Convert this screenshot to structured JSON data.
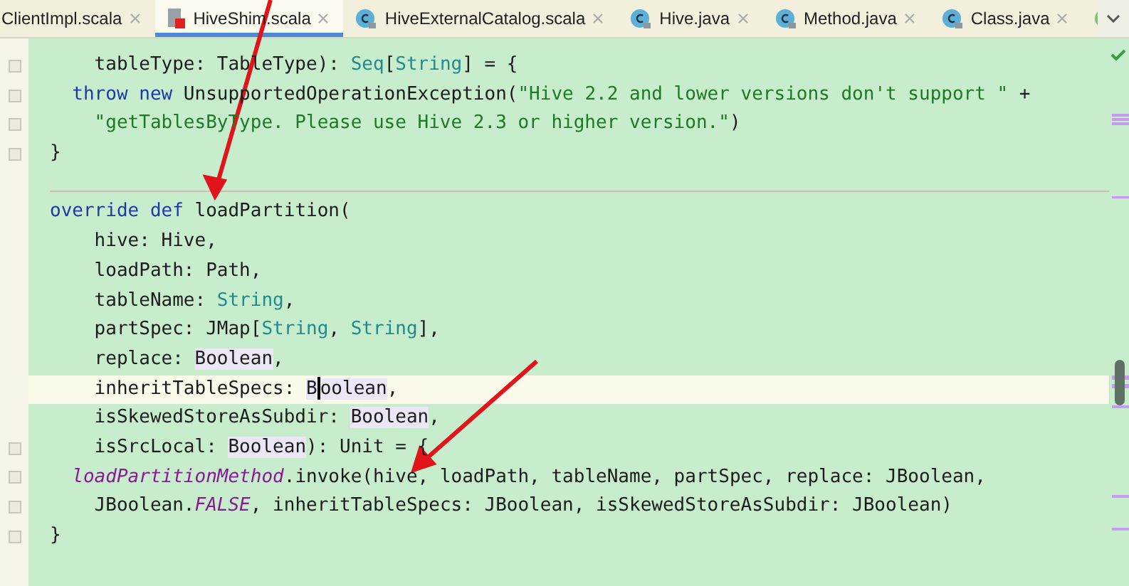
{
  "tabs": [
    {
      "label": "ClientImpl.scala",
      "kind": "cut",
      "selected": false
    },
    {
      "label": "HiveShim.scala",
      "kind": "scala",
      "selected": true
    },
    {
      "label": "HiveExternalCatalog.scala",
      "kind": "class",
      "selected": false
    },
    {
      "label": "Hive.java",
      "kind": "class",
      "selected": false
    },
    {
      "label": "Method.java",
      "kind": "class",
      "selected": false
    },
    {
      "label": "Class.java",
      "kind": "class",
      "selected": false
    },
    {
      "kind": "trait",
      "selected": false
    }
  ],
  "lines": [
    {
      "kind": "code",
      "fold": true,
      "current": false,
      "tokens": [
        {
          "kind": "plain",
          "text": "    tableType: TableType): "
        },
        {
          "kind": "type",
          "text": "Seq"
        },
        {
          "kind": "plain",
          "text": "["
        },
        {
          "kind": "type",
          "text": "String"
        },
        {
          "kind": "plain",
          "text": "] = {"
        }
      ]
    },
    {
      "kind": "code",
      "fold": true,
      "current": false,
      "tokens": [
        {
          "kind": "keyword",
          "text": "  throw new "
        },
        {
          "kind": "plain",
          "text": "UnsupportedOperationException("
        },
        {
          "kind": "string",
          "text": "\"Hive 2.2 and lower versions don't support \""
        },
        {
          "kind": "plain",
          "text": " +"
        }
      ]
    },
    {
      "kind": "code",
      "fold": true,
      "current": false,
      "tokens": [
        {
          "kind": "string",
          "text": "    \"getTablesByType. Please use Hive 2.3 or higher version.\""
        },
        {
          "kind": "plain",
          "text": ")"
        }
      ]
    },
    {
      "kind": "code",
      "fold": true,
      "current": false,
      "tokens": [
        {
          "kind": "plain",
          "text": "}"
        }
      ]
    },
    {
      "kind": "separator"
    },
    {
      "kind": "code",
      "fold": false,
      "current": false,
      "tokens": [
        {
          "kind": "keyword",
          "text": "override def "
        },
        {
          "kind": "plain",
          "text": "loadPartition("
        }
      ]
    },
    {
      "kind": "code",
      "fold": false,
      "current": false,
      "tokens": [
        {
          "kind": "plain",
          "text": "    hive: Hive,"
        }
      ]
    },
    {
      "kind": "code",
      "fold": false,
      "current": false,
      "tokens": [
        {
          "kind": "plain",
          "text": "    loadPath: Path,"
        }
      ]
    },
    {
      "kind": "code",
      "fold": false,
      "current": false,
      "tokens": [
        {
          "kind": "plain",
          "text": "    tableName: "
        },
        {
          "kind": "type",
          "text": "String"
        },
        {
          "kind": "plain",
          "text": ","
        }
      ]
    },
    {
      "kind": "code",
      "fold": false,
      "current": false,
      "tokens": [
        {
          "kind": "plain",
          "text": "    partSpec: JMap["
        },
        {
          "kind": "type",
          "text": "String"
        },
        {
          "kind": "plain",
          "text": ", "
        },
        {
          "kind": "type",
          "text": "String"
        },
        {
          "kind": "plain",
          "text": "],"
        }
      ]
    },
    {
      "kind": "code",
      "fold": false,
      "current": false,
      "tokens": [
        {
          "kind": "plain",
          "text": "    replace: "
        },
        {
          "kind": "usage",
          "text": "Boolean"
        },
        {
          "kind": "plain",
          "text": ","
        }
      ]
    },
    {
      "kind": "code",
      "fold": false,
      "current": true,
      "tokens": [
        {
          "kind": "plain",
          "text": "    inheritTableSpecs: "
        },
        {
          "kind": "usage",
          "text": "B"
        },
        {
          "kind": "caret"
        },
        {
          "kind": "usage",
          "text": "oolean"
        },
        {
          "kind": "plain",
          "text": ","
        }
      ]
    },
    {
      "kind": "code",
      "fold": false,
      "current": false,
      "tokens": [
        {
          "kind": "plain",
          "text": "    isSkewedStoreAsSubdir: "
        },
        {
          "kind": "usage",
          "text": "Boolean"
        },
        {
          "kind": "plain",
          "text": ","
        }
      ]
    },
    {
      "kind": "code",
      "fold": true,
      "current": false,
      "tokens": [
        {
          "kind": "plain",
          "text": "    isSrcLocal: "
        },
        {
          "kind": "usage",
          "text": "Boolean"
        },
        {
          "kind": "plain",
          "text": "): Unit = {"
        }
      ]
    },
    {
      "kind": "code",
      "fold": true,
      "current": false,
      "tokens": [
        {
          "kind": "member",
          "text": "  loadPartitionMethod"
        },
        {
          "kind": "plain",
          "text": ".invoke(hive, loadPath, tableName, partSpec, replace: JBoolean,"
        }
      ]
    },
    {
      "kind": "code",
      "fold": true,
      "current": false,
      "tokens": [
        {
          "kind": "plain",
          "text": "    JBoolean."
        },
        {
          "kind": "member",
          "text": "FALSE"
        },
        {
          "kind": "plain",
          "text": ", inheritTableSpecs: JBoolean, isSkewedStoreAsSubdir: JBoolean)"
        }
      ]
    },
    {
      "kind": "code",
      "fold": true,
      "current": false,
      "tokens": [
        {
          "kind": "plain",
          "text": "}"
        }
      ]
    }
  ]
}
